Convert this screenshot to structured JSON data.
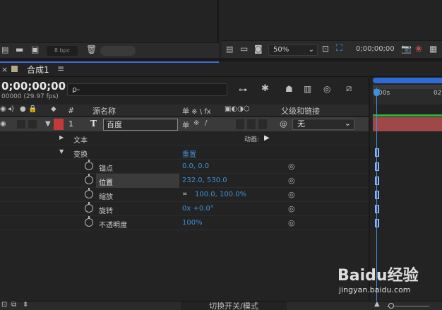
{
  "project_panel": {
    "bpc_label": "8 bpc"
  },
  "composition_viewer": {
    "zoom": "50%",
    "timecode": "0;00;00;00"
  },
  "timeline": {
    "tab_label": "合成1",
    "current_time": "0;00;00;00",
    "fps_text": "00000 (29.97 fps)",
    "search_placeholder": "ρ-",
    "columns": {
      "layer_num": "#",
      "source_name": "源名称",
      "switches": "单 ※ \\ fx",
      "parent_link": "父级和链接"
    },
    "layer": {
      "index": "1",
      "type_glyph": "T",
      "name": "百度",
      "parent": "无"
    },
    "groups": [
      {
        "label": "文本",
        "extra_label": "动画:"
      },
      {
        "label": "变换",
        "reset_label": "重置"
      }
    ],
    "properties": [
      {
        "label": "锚点",
        "value": "0.0, 0.0"
      },
      {
        "label": "位置",
        "value": "232.0, 530.0"
      },
      {
        "label": "缩放",
        "value": "100.0, 100.0%"
      },
      {
        "label": "旋转",
        "value": "0x +0.0°"
      },
      {
        "label": "不透明度",
        "value": "100%"
      }
    ],
    "ruler": {
      "start_label": "00s",
      "end_label": "02"
    }
  },
  "bottom_bar": {
    "toggle_label": "切换开关/模式"
  },
  "watermark": {
    "main": "Baidu经验",
    "sub": "jingyan.baidu.com"
  },
  "colors": {
    "accent_blue": "#3f8fdb",
    "layer_red": "#a04848",
    "label_red": "#c23a3a",
    "work_area_green": "#38b03e"
  }
}
